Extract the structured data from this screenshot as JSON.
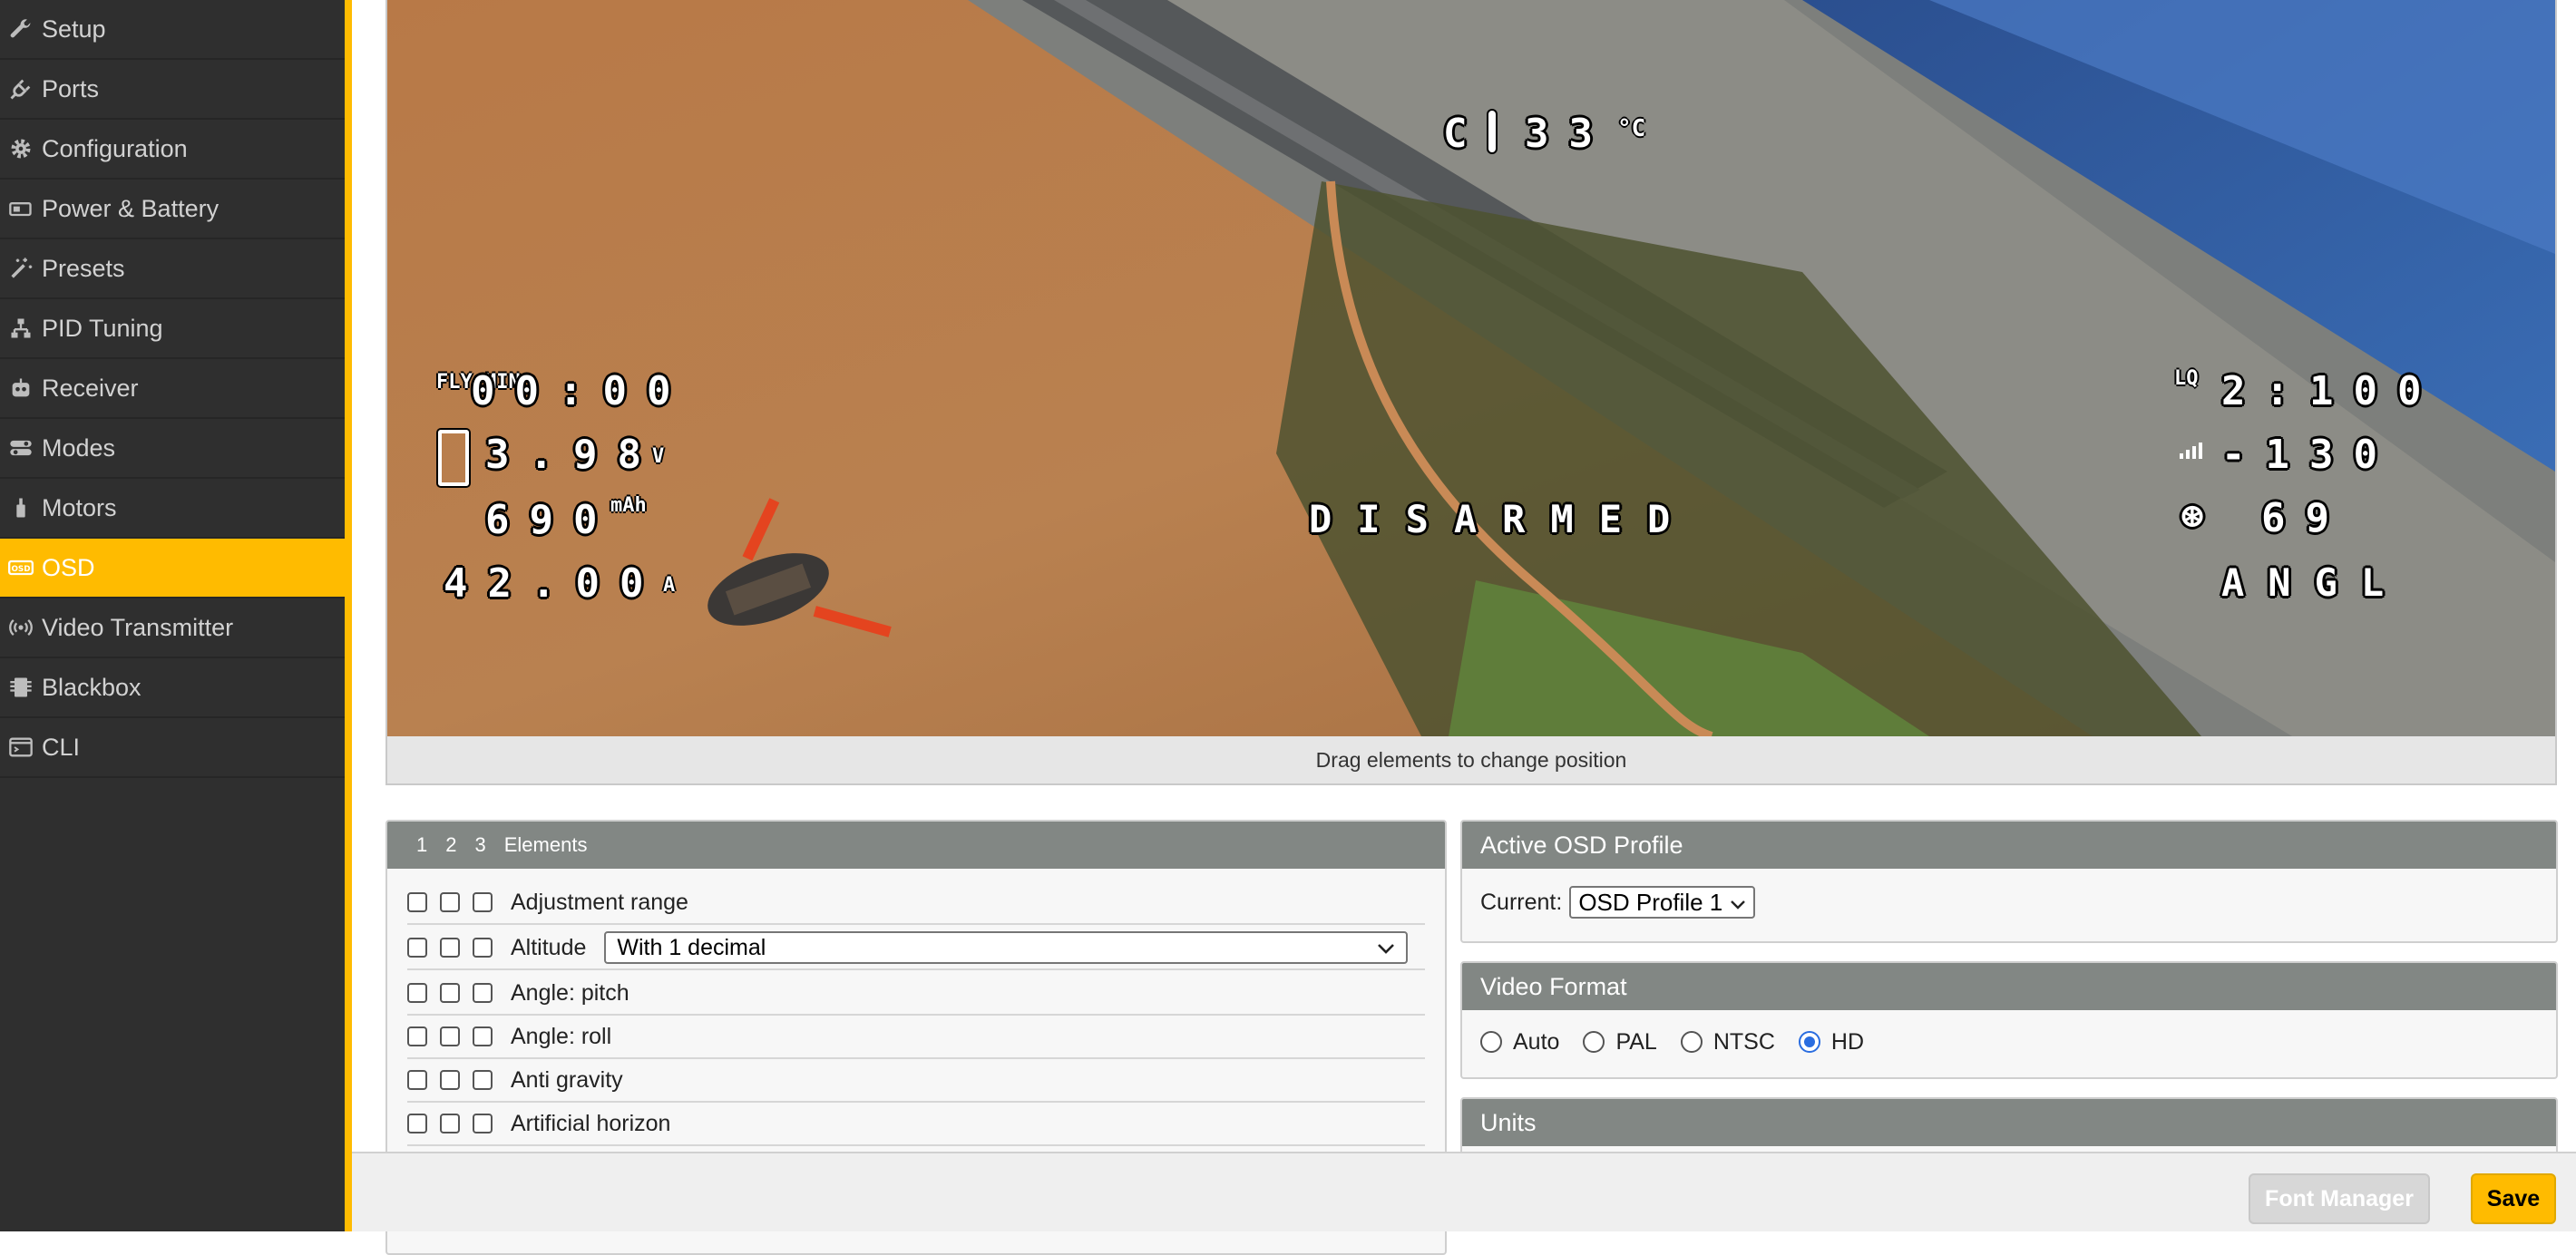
{
  "sidebar": {
    "items": [
      {
        "label": "Setup",
        "icon": "wrench-icon",
        "active": false
      },
      {
        "label": "Ports",
        "icon": "plug-icon",
        "active": false
      },
      {
        "label": "Configuration",
        "icon": "gear-icon",
        "active": false
      },
      {
        "label": "Power & Battery",
        "icon": "battery-icon",
        "active": false
      },
      {
        "label": "Presets",
        "icon": "magic-wand-icon",
        "active": false
      },
      {
        "label": "PID Tuning",
        "icon": "sliders-icon",
        "active": false
      },
      {
        "label": "Receiver",
        "icon": "robot-icon",
        "active": false
      },
      {
        "label": "Modes",
        "icon": "toggle-icon",
        "active": false
      },
      {
        "label": "Motors",
        "icon": "motor-icon",
        "active": false
      },
      {
        "label": "OSD",
        "icon": "osd-icon",
        "active": true
      },
      {
        "label": "Video Transmitter",
        "icon": "broadcast-icon",
        "active": false
      },
      {
        "label": "Blackbox",
        "icon": "blackbox-icon",
        "active": false
      },
      {
        "label": "CLI",
        "icon": "terminal-icon",
        "active": false
      }
    ],
    "accent_color": "#ffbb00"
  },
  "preview": {
    "hint": "Drag elements to change position",
    "osd": {
      "fly_time": "00:00",
      "fly_time_icon": "FLY MIN",
      "voltage": "3.98",
      "voltage_unit": "V",
      "mah": "690",
      "mah_unit": "mAh",
      "current": "42.00",
      "current_unit": "A",
      "temp_prefix": "C",
      "temp": "33",
      "temp_unit": "°C",
      "status": "DISARMED",
      "lq_icon": "LQ",
      "lq": "2:100",
      "rssi": "-130",
      "throttle": "69",
      "mode": "ANGL"
    }
  },
  "elements": {
    "header_tabs": [
      "1",
      "2",
      "3",
      "Elements"
    ],
    "rows": [
      {
        "label": "Adjustment range",
        "select": null
      },
      {
        "label": "Altitude",
        "select": "With 1 decimal"
      },
      {
        "label": "Angle: pitch",
        "select": null
      },
      {
        "label": "Angle: roll",
        "select": null
      },
      {
        "label": "Anti gravity",
        "select": null
      },
      {
        "label": "Artificial horizon",
        "select": null
      }
    ]
  },
  "active_profile": {
    "title": "Active OSD Profile",
    "current_label": "Current:",
    "current_value": "OSD Profile 1"
  },
  "video_format": {
    "title": "Video Format",
    "options": [
      "Auto",
      "PAL",
      "NTSC",
      "HD"
    ],
    "selected": "HD"
  },
  "units": {
    "title": "Units"
  },
  "footer": {
    "font_manager": "Font Manager",
    "save": "Save"
  }
}
